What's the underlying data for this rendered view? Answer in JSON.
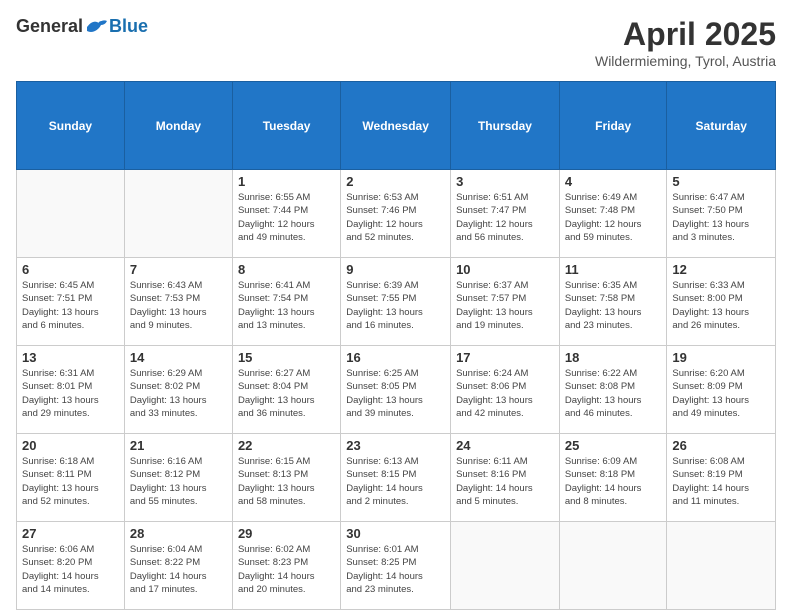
{
  "header": {
    "logo_general": "General",
    "logo_blue": "Blue",
    "month_title": "April 2025",
    "location": "Wildermieming, Tyrol, Austria"
  },
  "weekdays": [
    "Sunday",
    "Monday",
    "Tuesday",
    "Wednesday",
    "Thursday",
    "Friday",
    "Saturday"
  ],
  "weeks": [
    [
      {
        "day": "",
        "info": ""
      },
      {
        "day": "",
        "info": ""
      },
      {
        "day": "1",
        "info": "Sunrise: 6:55 AM\nSunset: 7:44 PM\nDaylight: 12 hours\nand 49 minutes."
      },
      {
        "day": "2",
        "info": "Sunrise: 6:53 AM\nSunset: 7:46 PM\nDaylight: 12 hours\nand 52 minutes."
      },
      {
        "day": "3",
        "info": "Sunrise: 6:51 AM\nSunset: 7:47 PM\nDaylight: 12 hours\nand 56 minutes."
      },
      {
        "day": "4",
        "info": "Sunrise: 6:49 AM\nSunset: 7:48 PM\nDaylight: 12 hours\nand 59 minutes."
      },
      {
        "day": "5",
        "info": "Sunrise: 6:47 AM\nSunset: 7:50 PM\nDaylight: 13 hours\nand 3 minutes."
      }
    ],
    [
      {
        "day": "6",
        "info": "Sunrise: 6:45 AM\nSunset: 7:51 PM\nDaylight: 13 hours\nand 6 minutes."
      },
      {
        "day": "7",
        "info": "Sunrise: 6:43 AM\nSunset: 7:53 PM\nDaylight: 13 hours\nand 9 minutes."
      },
      {
        "day": "8",
        "info": "Sunrise: 6:41 AM\nSunset: 7:54 PM\nDaylight: 13 hours\nand 13 minutes."
      },
      {
        "day": "9",
        "info": "Sunrise: 6:39 AM\nSunset: 7:55 PM\nDaylight: 13 hours\nand 16 minutes."
      },
      {
        "day": "10",
        "info": "Sunrise: 6:37 AM\nSunset: 7:57 PM\nDaylight: 13 hours\nand 19 minutes."
      },
      {
        "day": "11",
        "info": "Sunrise: 6:35 AM\nSunset: 7:58 PM\nDaylight: 13 hours\nand 23 minutes."
      },
      {
        "day": "12",
        "info": "Sunrise: 6:33 AM\nSunset: 8:00 PM\nDaylight: 13 hours\nand 26 minutes."
      }
    ],
    [
      {
        "day": "13",
        "info": "Sunrise: 6:31 AM\nSunset: 8:01 PM\nDaylight: 13 hours\nand 29 minutes."
      },
      {
        "day": "14",
        "info": "Sunrise: 6:29 AM\nSunset: 8:02 PM\nDaylight: 13 hours\nand 33 minutes."
      },
      {
        "day": "15",
        "info": "Sunrise: 6:27 AM\nSunset: 8:04 PM\nDaylight: 13 hours\nand 36 minutes."
      },
      {
        "day": "16",
        "info": "Sunrise: 6:25 AM\nSunset: 8:05 PM\nDaylight: 13 hours\nand 39 minutes."
      },
      {
        "day": "17",
        "info": "Sunrise: 6:24 AM\nSunset: 8:06 PM\nDaylight: 13 hours\nand 42 minutes."
      },
      {
        "day": "18",
        "info": "Sunrise: 6:22 AM\nSunset: 8:08 PM\nDaylight: 13 hours\nand 46 minutes."
      },
      {
        "day": "19",
        "info": "Sunrise: 6:20 AM\nSunset: 8:09 PM\nDaylight: 13 hours\nand 49 minutes."
      }
    ],
    [
      {
        "day": "20",
        "info": "Sunrise: 6:18 AM\nSunset: 8:11 PM\nDaylight: 13 hours\nand 52 minutes."
      },
      {
        "day": "21",
        "info": "Sunrise: 6:16 AM\nSunset: 8:12 PM\nDaylight: 13 hours\nand 55 minutes."
      },
      {
        "day": "22",
        "info": "Sunrise: 6:15 AM\nSunset: 8:13 PM\nDaylight: 13 hours\nand 58 minutes."
      },
      {
        "day": "23",
        "info": "Sunrise: 6:13 AM\nSunset: 8:15 PM\nDaylight: 14 hours\nand 2 minutes."
      },
      {
        "day": "24",
        "info": "Sunrise: 6:11 AM\nSunset: 8:16 PM\nDaylight: 14 hours\nand 5 minutes."
      },
      {
        "day": "25",
        "info": "Sunrise: 6:09 AM\nSunset: 8:18 PM\nDaylight: 14 hours\nand 8 minutes."
      },
      {
        "day": "26",
        "info": "Sunrise: 6:08 AM\nSunset: 8:19 PM\nDaylight: 14 hours\nand 11 minutes."
      }
    ],
    [
      {
        "day": "27",
        "info": "Sunrise: 6:06 AM\nSunset: 8:20 PM\nDaylight: 14 hours\nand 14 minutes."
      },
      {
        "day": "28",
        "info": "Sunrise: 6:04 AM\nSunset: 8:22 PM\nDaylight: 14 hours\nand 17 minutes."
      },
      {
        "day": "29",
        "info": "Sunrise: 6:02 AM\nSunset: 8:23 PM\nDaylight: 14 hours\nand 20 minutes."
      },
      {
        "day": "30",
        "info": "Sunrise: 6:01 AM\nSunset: 8:25 PM\nDaylight: 14 hours\nand 23 minutes."
      },
      {
        "day": "",
        "info": ""
      },
      {
        "day": "",
        "info": ""
      },
      {
        "day": "",
        "info": ""
      }
    ]
  ]
}
